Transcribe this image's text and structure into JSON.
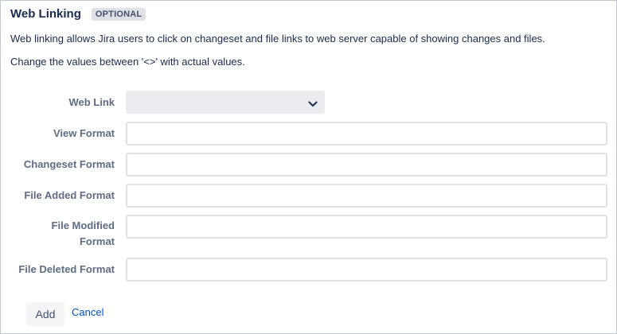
{
  "header": {
    "title": "Web Linking",
    "badge": "OPTIONAL"
  },
  "description": {
    "line1": "Web linking allows Jira users to click on changeset and file links to web server capable of showing changes and files.",
    "line2": "Change the values between '<>' with actual values."
  },
  "form": {
    "web_link": {
      "label": "Web Link",
      "value": ""
    },
    "view_format": {
      "label": "View Format",
      "value": ""
    },
    "changeset_format": {
      "label": "Changeset Format",
      "value": ""
    },
    "file_added_format": {
      "label": "File Added Format",
      "value": ""
    },
    "file_modified_format": {
      "label_line1": "File Modified",
      "label_line2": "Format",
      "value": ""
    },
    "file_deleted_format": {
      "label": "File Deleted Format",
      "value": ""
    }
  },
  "actions": {
    "add_label": "Add",
    "cancel_label": "Cancel"
  },
  "icons": {
    "select_arrow": "chevron-down-icon"
  },
  "colors": {
    "link": "#0052cc",
    "label": "#5e6c84",
    "text": "#172b4d"
  }
}
